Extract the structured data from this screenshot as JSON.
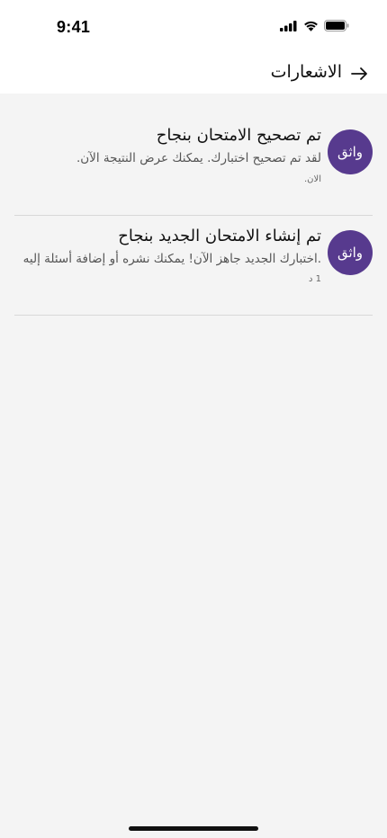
{
  "status_bar": {
    "time": "9:41"
  },
  "header": {
    "title": "الاشعارات",
    "back_icon": "arrow-right-icon"
  },
  "notifications": [
    {
      "avatar_text": "واثق",
      "title": "تم تصحيح الامتحان بنجاح",
      "body": "لقد تم تصحيح اختبارك. يمكنك عرض النتيجة الآن.",
      "time": "الان."
    },
    {
      "avatar_text": "واثق",
      "title": "تم إنشاء الامتحان الجديد بنجاح",
      "body": ".اختبارك الجديد جاهز الآن! يمكنك نشره أو إضافة أسئلة إليه",
      "time": "1 د"
    }
  ],
  "colors": {
    "accent": "#573a8e",
    "background": "#f4f4f4",
    "header_bg": "#ffffff"
  }
}
